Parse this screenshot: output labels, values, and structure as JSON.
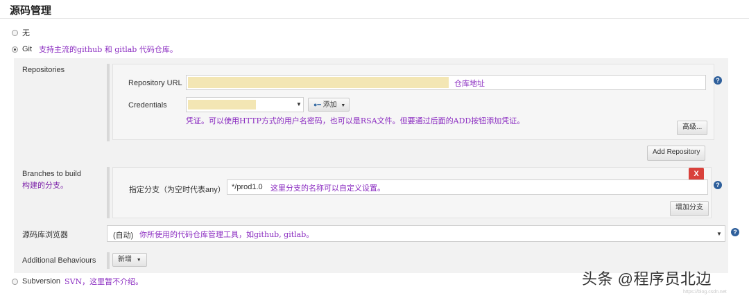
{
  "section_title": "源码管理",
  "scm_options": {
    "none_label": "无",
    "git_label": "Git",
    "git_note": "支持主流的github 和 gitlab 代码仓库。",
    "subversion_label": "Subversion",
    "subversion_note": "SVN，这里暂不介绍。"
  },
  "repositories": {
    "label": "Repositories",
    "url_label": "Repository URL",
    "url_note": "仓库地址",
    "credentials_label": "Credentials",
    "add_button": "添加",
    "credentials_note": "凭证。可以使用HTTP方式的用户名密码，也可以是RSA文件。但要通过后面的ADD按钮添加凭证。",
    "advanced_button": "高级...",
    "add_repository_button": "Add Repository"
  },
  "branches": {
    "label": "Branches to build",
    "note": "构建的分支。",
    "delete_button": "X",
    "branch_label": "指定分支（为空时代表any）",
    "branch_value": "*/prod1.0",
    "branch_note": "这里分支的名称可以自定义设置。",
    "add_branch_button": "增加分支"
  },
  "browser": {
    "label": "源码库浏览器",
    "selected": "(自动)",
    "note": "你所使用的代码仓库管理工具，如github, gitlab。"
  },
  "additional_behaviours": {
    "label": "Additional Behaviours",
    "button": "新增"
  },
  "help_glyph": "?",
  "watermark": {
    "text": "头条 @程序员北边",
    "sub": "https://blog.csdn.net"
  },
  "colors": {
    "note": "#8a2bc0",
    "delete": "#d9413b",
    "help": "#2e5f9b",
    "highlight": "#f3e6b4"
  }
}
